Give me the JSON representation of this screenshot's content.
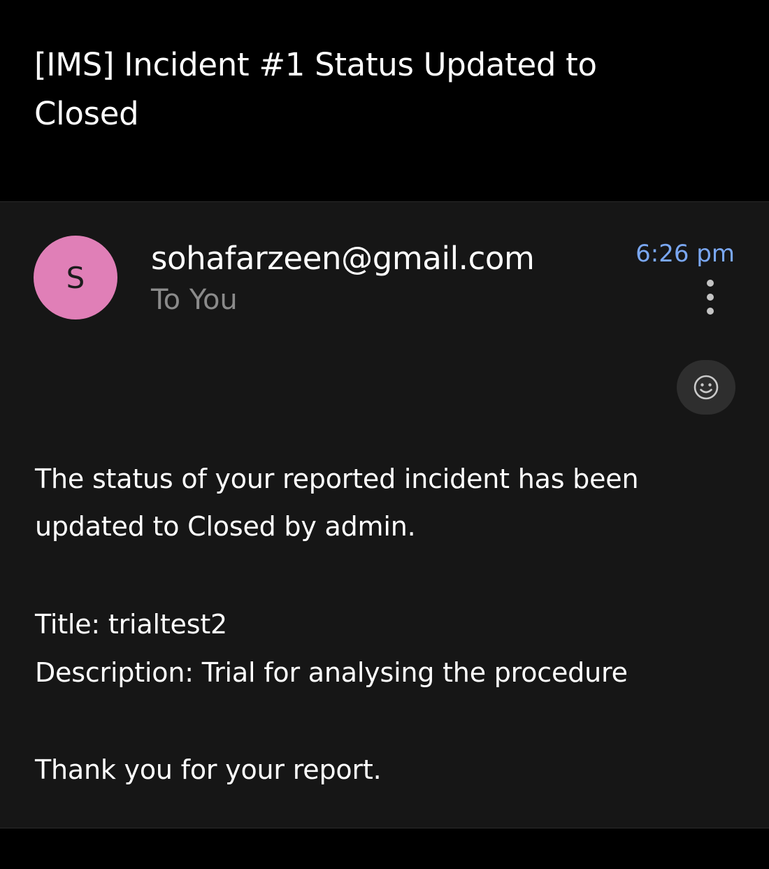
{
  "email": {
    "subject": "[IMS] Incident #1 Status Updated to Closed",
    "sender": {
      "avatar_letter": "S",
      "avatar_color": "#e07fb7",
      "address": "sohafarzeen@gmail.com",
      "recipient": "To You",
      "time": "6:26 pm",
      "time_color": "#7aa7f2"
    },
    "icons": {
      "more": "more-vert-icon",
      "reaction": "emoji-smile-icon"
    },
    "body": {
      "paragraph": "The status of your reported incident has been updated to Closed by admin.",
      "title_line": "Title: trialtest2",
      "description_line": "Description: Trial for analysing the procedure",
      "closing": "Thank you for your report."
    }
  }
}
